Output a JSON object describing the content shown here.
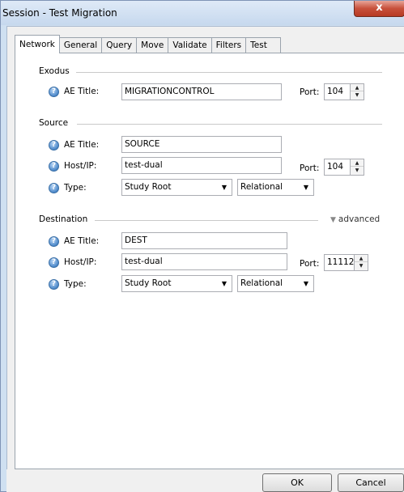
{
  "window": {
    "title": "Session - Test Migration",
    "close_label": "x"
  },
  "tabs": [
    {
      "label": "Network",
      "active": true
    },
    {
      "label": "General",
      "active": false
    },
    {
      "label": "Query",
      "active": false
    },
    {
      "label": "Move",
      "active": false
    },
    {
      "label": "Validate",
      "active": false
    },
    {
      "label": "Filters",
      "active": false
    },
    {
      "label": "Test",
      "active": false
    }
  ],
  "exodus": {
    "section": "Exodus",
    "ae_title_label": "AE Title:",
    "ae_title_value": "MIGRATIONCONTROL",
    "port_label": "Port:",
    "port_value": "104"
  },
  "source": {
    "section": "Source",
    "ae_title_label": "AE Title:",
    "ae_title_value": "SOURCE",
    "host_label": "Host/IP:",
    "host_value": "test-dual",
    "port_label": "Port:",
    "port_value": "104",
    "type_label": "Type:",
    "type_value": "Study Root",
    "model_value": "Relational"
  },
  "destination": {
    "section": "Destination",
    "advanced_label": "advanced",
    "ae_title_label": "AE Title:",
    "ae_title_value": "DEST",
    "host_label": "Host/IP:",
    "host_value": "test-dual",
    "port_label": "Port:",
    "port_value": "11112",
    "type_label": "Type:",
    "type_value": "Study Root",
    "model_value": "Relational"
  },
  "buttons": {
    "ok": "OK",
    "cancel": "Cancel"
  },
  "icons": {
    "help": "help-icon",
    "dropdown": "chevron-down-icon",
    "spin_up": "arrow-up-icon",
    "spin_down": "arrow-down-icon",
    "advanced": "chevron-down-icon"
  },
  "colors": {
    "title_bar": "#c6d8ee",
    "close_button": "#c7503b",
    "panel": "#ffffff",
    "dialog_bg": "#f0f0f0"
  }
}
